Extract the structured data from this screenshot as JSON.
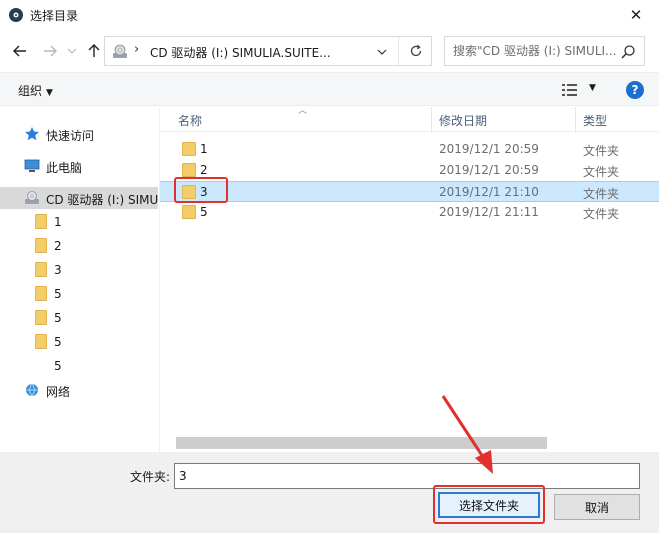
{
  "window": {
    "title": "选择目录",
    "close_glyph": "✕"
  },
  "address": {
    "path": "CD 驱动器 (I:) SIMULIA.SUITE...",
    "separator": "›"
  },
  "search": {
    "placeholder": "搜索\"CD 驱动器 (I:) SIMULI..."
  },
  "toolbar": {
    "organize": "组织"
  },
  "sidebar": {
    "items": [
      {
        "label": "快速访问",
        "icon": "quick-access-star-icon"
      },
      {
        "label": "此电脑",
        "icon": "this-pc-icon"
      },
      {
        "label": "CD 驱动器 (I:) SIMU",
        "icon": "cd-drive-icon",
        "selected": true
      },
      {
        "label": "1",
        "icon": "folder-icon"
      },
      {
        "label": "2",
        "icon": "folder-icon"
      },
      {
        "label": "3",
        "icon": "folder-icon"
      },
      {
        "label": "5",
        "icon": "folder-icon"
      },
      {
        "label": "5",
        "icon": "folder-icon"
      },
      {
        "label": "5",
        "icon": "folder-icon"
      },
      {
        "label": "5",
        "icon": "folder-icon"
      },
      {
        "label": "网络",
        "icon": "network-icon"
      }
    ]
  },
  "columns": {
    "name": "名称",
    "date": "修改日期",
    "type": "类型"
  },
  "files": [
    {
      "name": "1",
      "date": "2019/12/1 20:59",
      "type": "文件夹"
    },
    {
      "name": "2",
      "date": "2019/12/1 20:59",
      "type": "文件夹"
    },
    {
      "name": "3",
      "date": "2019/12/1 21:10",
      "type": "文件夹",
      "selected": true
    },
    {
      "name": "5",
      "date": "2019/12/1 21:11",
      "type": "文件夹"
    }
  ],
  "footer": {
    "folder_label": "文件夹:",
    "folder_value": "3",
    "select_button": "选择文件夹",
    "cancel_button": "取消"
  },
  "colors": {
    "accent": "#2b7ad6",
    "selection": "#cce8ff",
    "annotation": "#e0302f",
    "folder": "#f2cd6a"
  }
}
